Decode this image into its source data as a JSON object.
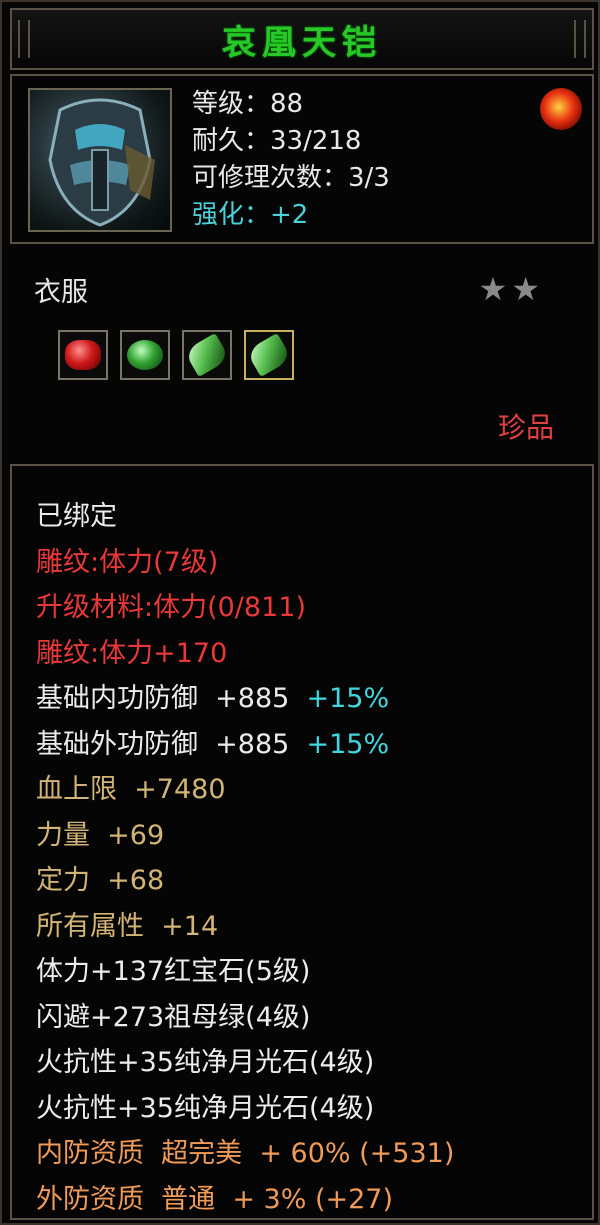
{
  "item": {
    "name": "哀凰天铠",
    "stats": [
      {
        "label": "等级：88"
      },
      {
        "label": "耐久：33/218"
      },
      {
        "label": "可修理次数：3/3"
      },
      {
        "label": "强化：+2"
      }
    ],
    "type": "衣服",
    "stars": "★★",
    "quality": "珍品",
    "gems": [
      {
        "icon": "ruby-gem-icon"
      },
      {
        "icon": "emerald-gem-icon"
      },
      {
        "icon": "moonstone-gem-icon"
      },
      {
        "icon": "moonstone-gem-icon"
      }
    ]
  },
  "attributes": {
    "bound": "已绑定",
    "engrave": "雕纹:体力(7级)",
    "upgrade": "升级材料:体力(0/811)",
    "engrave_bonus": "雕纹:体力+170",
    "inner_def": "基础内功防御  +885",
    "inner_def_pct": "+15%",
    "outer_def": "基础外功防御  +885",
    "outer_def_pct": "+15%",
    "hp": "血上限  +7480",
    "str": "力量  +69",
    "focus": "定力  +68",
    "all": "所有属性  +14",
    "gem1": "体力+137红宝石(5级)",
    "gem2": "闪避+273祖母绿(4级)",
    "gem3": "火抗性+35纯净月光石(4级)",
    "gem4": "火抗性+35纯净月光石(4级)",
    "inner_quality": "内防资质  超完美  + 60% (+531)",
    "outer_quality": "外防资质  普通  + 3% (+27)"
  },
  "colors": {
    "title": "#28c828",
    "engrave": "#e83838",
    "base": "#d2b474",
    "percent": "#40d8e0",
    "aptitude": "#f09a58"
  }
}
